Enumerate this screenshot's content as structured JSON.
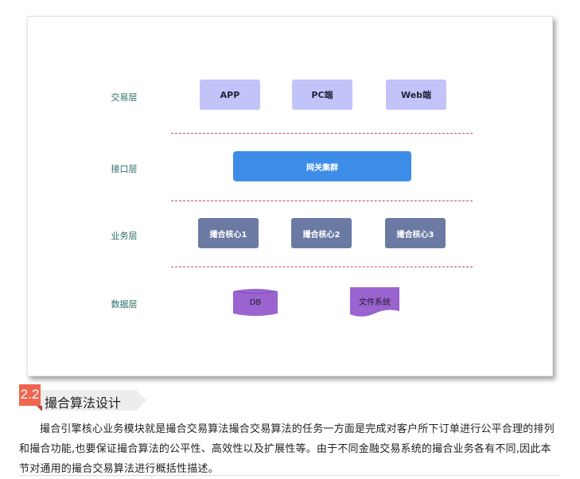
{
  "diagram": {
    "layers": [
      {
        "key": "trade",
        "label": "交易层",
        "nodes": [
          "APP",
          "PC端",
          "Web端"
        ]
      },
      {
        "key": "interface",
        "label": "接口层",
        "nodes": [
          "网关集群"
        ]
      },
      {
        "key": "business",
        "label": "业务层",
        "nodes": [
          "撮合核心1",
          "撮合核心2",
          "撮合核心3"
        ]
      },
      {
        "key": "data",
        "label": "数据层",
        "nodes": [
          "DB",
          "文件系统"
        ]
      }
    ],
    "colors": {
      "layer_label": "#2c6f66",
      "trade_box": "#c2c3f9",
      "gateway_box": "#3d8de8",
      "core_box": "#6a7aa2",
      "data_shape": "#9a63cf",
      "divider": "#c74a5b"
    }
  },
  "section": {
    "number": "2.2",
    "title": "撮合算法设计"
  },
  "paragraph": "撮合引擎核心业务模块就是撮合交易算法撮合交易算法的任务一方面是完成对客户所下订单进行公平合理的排列和撮合功能,也要保证撮合算法的公平性、高效性以及扩展性等。由于不同金融交易系统的撮合业务各有不同,因此本节对通用的撮合交易算法进行概括性描述。"
}
